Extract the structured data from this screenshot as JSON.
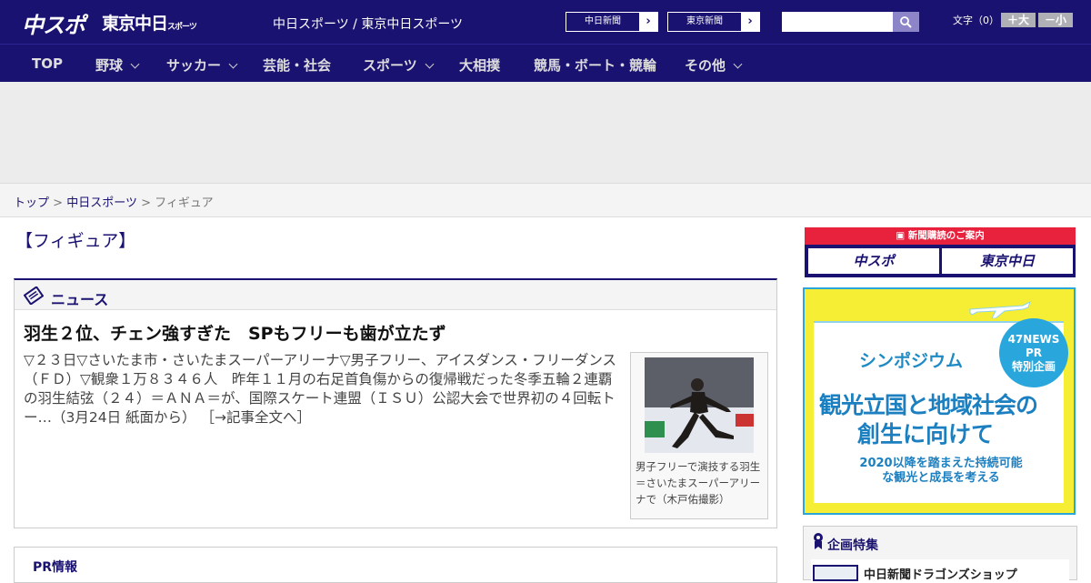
{
  "header": {
    "logo_chuspo": "中スポ",
    "logo_tokyo": "東京中日",
    "logo_tokyo_small": "スポーツ",
    "site_names": "中日スポーツ / 東京中日スポーツ",
    "newspaper_links": [
      {
        "label": "中日新聞"
      },
      {
        "label": "東京新聞"
      }
    ],
    "search_placeholder": "",
    "font_size_label": "文字（0）",
    "font_larger": "＋大",
    "font_smaller": "－小"
  },
  "nav": {
    "items": [
      {
        "label": "TOP",
        "has_menu": false
      },
      {
        "label": "野球",
        "has_menu": true
      },
      {
        "label": "サッカー",
        "has_menu": true
      },
      {
        "label": "芸能・社会",
        "has_menu": false
      },
      {
        "label": "スポーツ",
        "has_menu": true
      },
      {
        "label": "大相撲",
        "has_menu": false
      },
      {
        "label": "競馬・ボート・競輪",
        "has_menu": false
      },
      {
        "label": "その他",
        "has_menu": true
      }
    ]
  },
  "breadcrumb": {
    "top": "トップ",
    "sep": ">",
    "section": "中日スポーツ",
    "current": "フィギュア"
  },
  "page_title": "【フィギュア】",
  "news": {
    "heading": "ニュース",
    "article_title": "羽生２位、チェン強すぎた　SPもフリーも歯が立たず",
    "article_body": "▽２３日▽さいたま市・さいたまスーパーアリーナ▽男子フリー、アイスダンス・フリーダンス（ＦＤ）▽観衆１万８３４６人　昨年１１月の右足首負傷からの復帰戦だった冬季五輪２連覇の羽生結弦（２４）＝ＡＮＡ＝が、国際スケート連盟（ＩＳＵ）公認大会で世界初の４回転トー…（3月24日 紙面から）",
    "read_more": "［→記事全文へ］",
    "photo_caption": "男子フリーで演技する羽生＝さいたまスーパーアリーナで（木戸佑撮影）"
  },
  "pr": {
    "label": "PR情報"
  },
  "sidebar": {
    "subscribe_banner": "新聞購読のご案内",
    "subscribe_logo_1": "中スポ",
    "subscribe_logo_2": "東京中日",
    "symposium": {
      "badge_line1": "47NEWS",
      "badge_line2": "PR",
      "badge_line3": "特別企画",
      "title": "シンポジウム",
      "main1": "観光立国と地域社会の",
      "main2": "創生に向けて",
      "sub": "2020以降を踏まえた持続可能な観光と成長を考える"
    },
    "feature": {
      "heading": "企画特集",
      "item": "中日新聞ドラゴンズショップ"
    }
  }
}
